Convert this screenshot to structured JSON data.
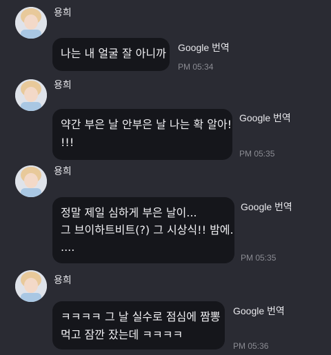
{
  "messages": [
    {
      "sender": "용희",
      "lines": [
        "나는 내 얼굴 잘 아니까"
      ],
      "translate": "Google 번역",
      "time": "PM 05:34"
    },
    {
      "sender": "용희",
      "lines": [
        "약간 부은 날 안부은 날 나는 확 알아!",
        "!!!"
      ],
      "translate": "Google 번역",
      "time": "PM 05:35"
    },
    {
      "sender": "용희",
      "lines": [
        "정말 제일 심하게 부은 날이...",
        "그 브이하트비트(?) 그 시상식!! 밤에.",
        "...."
      ],
      "translate": "Google 번역",
      "time": "PM 05:35"
    },
    {
      "sender": "용희",
      "lines": [
        "ㅋㅋㅋㅋ 그 날 실수로 점심에 짬뽕",
        "먹고 잠깐 잤는데 ㅋㅋㅋㅋ"
      ],
      "translate": "Google 번역",
      "time": "PM 05:36"
    }
  ],
  "colors": {
    "background": "#2a2b33",
    "bubble": "#15161b",
    "time": "#8b8c93"
  },
  "icons": {
    "avatar": "profile-photo-avatar"
  }
}
